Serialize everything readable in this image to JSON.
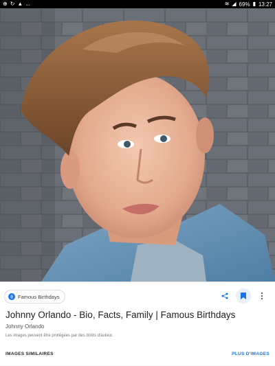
{
  "status_bar": {
    "left_icons": [
      "browser-icon",
      "sync-icon",
      "notification-icon"
    ],
    "more": "...",
    "battery": "69%",
    "time": "13:27"
  },
  "card": {
    "source_name": "Famous Birthdays",
    "title": "Johnny Orlando - Bio, Facts, Family | Famous Birthdays",
    "subtitle": "Johnny Orlando",
    "disclaimer": "Les images peuvent être protégées par des droits d'auteur.",
    "similar_label": "IMAGES SIMILAIRES",
    "more_label": "PLUS D'IMAGES"
  },
  "colors": {
    "accent": "#1a73e8",
    "title": "#202124",
    "status_bg": "#000000"
  }
}
